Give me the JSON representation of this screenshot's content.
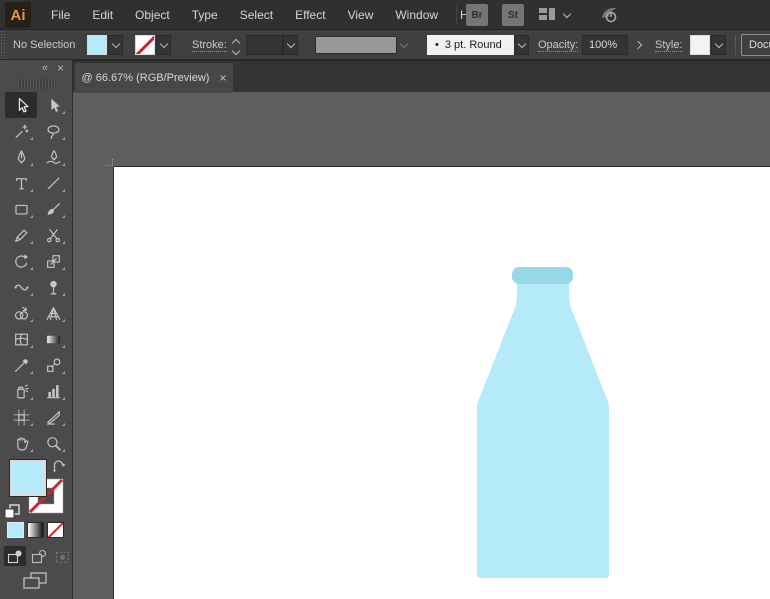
{
  "app": {
    "logo": "Ai"
  },
  "menu_bar": {
    "items": [
      "File",
      "Edit",
      "Object",
      "Type",
      "Select",
      "Effect",
      "View",
      "Window",
      "Help"
    ],
    "bridge_label": "Br",
    "stock_label": "St"
  },
  "control_bar": {
    "selection_status": "No Selection",
    "stroke_label": "Stroke:",
    "brush_bullet": "•",
    "brush_value": "3 pt. Round",
    "opacity_label": "Opacity:",
    "opacity_value": "100%",
    "style_label": "Style:",
    "document_setup_label": "Docu"
  },
  "tab_bar": {
    "document_tab_title": "@ 66.67% (RGB/Preview)",
    "close_glyph": "×"
  },
  "tools_panel": {
    "collapse_glyph": "«",
    "close_glyph": "×",
    "tools": [
      {
        "name": "selection-tool",
        "selected": true
      },
      {
        "name": "direct-selection-tool"
      },
      {
        "name": "magic-wand-tool"
      },
      {
        "name": "lasso-tool"
      },
      {
        "name": "pen-tool"
      },
      {
        "name": "curvature-tool"
      },
      {
        "name": "type-tool"
      },
      {
        "name": "line-segment-tool"
      },
      {
        "name": "rectangle-tool"
      },
      {
        "name": "paintbrush-tool"
      },
      {
        "name": "shaper-tool"
      },
      {
        "name": "scissors-tool"
      },
      {
        "name": "rotate-tool"
      },
      {
        "name": "scale-tool"
      },
      {
        "name": "width-tool"
      },
      {
        "name": "puppet-warp-tool"
      },
      {
        "name": "shape-builder-tool"
      },
      {
        "name": "perspective-grid-tool"
      },
      {
        "name": "mesh-tool"
      },
      {
        "name": "gradient-tool"
      },
      {
        "name": "eyedropper-tool"
      },
      {
        "name": "blend-tool"
      },
      {
        "name": "symbol-sprayer-tool"
      },
      {
        "name": "column-graph-tool"
      },
      {
        "name": "artboard-tool"
      },
      {
        "name": "slice-tool"
      },
      {
        "name": "hand-tool"
      },
      {
        "name": "zoom-tool"
      }
    ]
  },
  "colors": {
    "fill_blue": "#b5eaf8",
    "bottle_lip_blue": "#97d9e8",
    "none_red": "#cf2332",
    "canvas_gray": "#5f5f5f",
    "artboard_white": "#ffffff",
    "panel_gray": "#4b4b4b"
  },
  "artwork": {
    "bottle_body_fill": "#b5eaf8",
    "bottle_lip_fill": "#97d9e8"
  }
}
